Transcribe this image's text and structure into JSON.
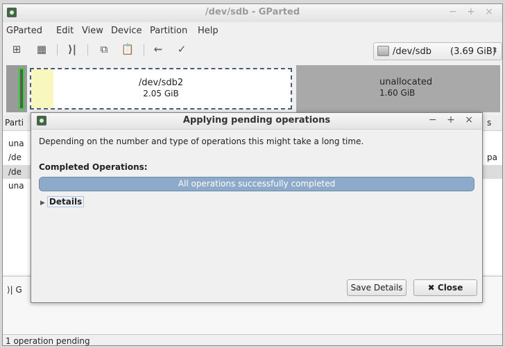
{
  "window": {
    "title": "/dev/sdb - GParted",
    "controls": "− + ×"
  },
  "menu": [
    "GParted",
    "Edit",
    "View",
    "Device",
    "Partition",
    "Help"
  ],
  "toolbar": {
    "new": "⊞",
    "delete": "▦",
    "resize": "⟩|",
    "copy": "⧉",
    "paste": "📋",
    "undo": "⇜",
    "apply": "✓"
  },
  "device": {
    "path": "/dev/sdb",
    "size": "(3.69 GiB)"
  },
  "disk_map": {
    "sdb2": {
      "name": "/dev/sdb2",
      "size": "2.05 GiB"
    },
    "unallocated": {
      "name": "unallocated",
      "size": "1.60 GiB"
    }
  },
  "partition_list": {
    "header_left": "Parti",
    "header_right": "s",
    "rows": [
      "una",
      "/de",
      "/de",
      "una"
    ],
    "row2_right": "pa"
  },
  "pending": {
    "label": "⟩| G"
  },
  "status": {
    "text": "1 operation pending"
  },
  "dialog": {
    "title": "Applying pending operations",
    "controls": "− + ×",
    "description": "Depending on the number and type of operations this might take a long time.",
    "completed_label": "Completed Operations:",
    "progress_text": "All operations successfully completed",
    "progress_fraction": 1.0,
    "details_label": "Details",
    "save_details": "Save Details",
    "close": "✖ Close"
  },
  "colors": {
    "progress": "#8eaacb",
    "used_space": "#f7f7be",
    "active_partition": "#2fd62f",
    "unallocated": "#a9a9a9"
  }
}
